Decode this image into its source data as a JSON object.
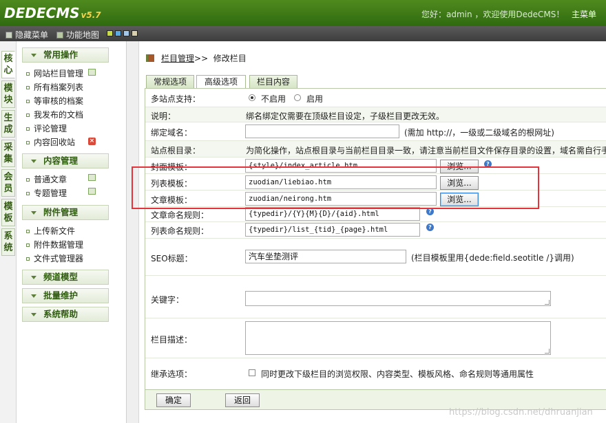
{
  "header": {
    "logo": "DEDECMS",
    "version": "v5.7",
    "greeting": "您好：admin ，欢迎使用DedeCMS！",
    "main_menu": "主菜单"
  },
  "toolbar": {
    "hide_menu": "隐藏菜单",
    "site_map": "功能地图",
    "swatch_colors": [
      "#c8d94a",
      "#5aa9e0",
      "#a3c7e8",
      "#d8cfae"
    ]
  },
  "vtabs": [
    {
      "label": "核心"
    },
    {
      "label": "模块"
    },
    {
      "label": "生成"
    },
    {
      "label": "采集"
    },
    {
      "label": "会员"
    },
    {
      "label": "模板"
    },
    {
      "label": "系统"
    }
  ],
  "menu": {
    "common": {
      "title": "常用操作",
      "items": [
        "网站栏目管理",
        "所有档案列表",
        "等审核的档案",
        "我发布的文档",
        "评论管理",
        "内容回收站"
      ]
    },
    "content": {
      "title": "内容管理",
      "items": [
        "普通文章",
        "专题管理"
      ]
    },
    "attach": {
      "title": "附件管理",
      "items": [
        "上传新文件",
        "附件数据管理",
        "文件式管理器"
      ]
    },
    "channel": {
      "title": "频道模型"
    },
    "batch": {
      "title": "批量维护"
    },
    "help": {
      "title": "系统帮助"
    }
  },
  "breadcrumb": {
    "link": "栏目管理",
    "sep": ">>",
    "current": "修改栏目"
  },
  "tabs": [
    "常规选项",
    "高级选项",
    "栏目内容"
  ],
  "form": {
    "multisite": {
      "label": "多站点支持：",
      "opt_off": "不启用",
      "opt_on": "启用",
      "selected": "不启用"
    },
    "note": {
      "label": "说明：",
      "text": "绑名绑定仅需要在顶级栏目设定，子级栏目更改无效。"
    },
    "domain": {
      "label": "绑定域名：",
      "value": "",
      "hint": "(需加 http://，一级或二级域名的根网址)"
    },
    "siteroot": {
      "label": "站点根目录：",
      "text": "为简化操作，站点根目录与当前栏目目录一致，请注意当前栏目文件保存目录的设置，域名需自行手"
    },
    "cover_tpl": {
      "label": "封面模板：",
      "value": "{style}/index_article.htm",
      "browse": "浏览..."
    },
    "list_tpl": {
      "label": "列表模板：",
      "value": "zuodian/liebiao.htm",
      "browse": "浏览..."
    },
    "article_tpl": {
      "label": "文章模板：",
      "value": "zuodian/neirong.htm",
      "browse": "浏览..."
    },
    "article_rule": {
      "label": "文章命名规则：",
      "value": "{typedir}/{Y}{M}{D}/{aid}.html"
    },
    "list_rule": {
      "label": "列表命名规则：",
      "value": "{typedir}/list_{tid}_{page}.html"
    },
    "seo": {
      "label": "SEO标题：",
      "value": "汽车坐垫测评",
      "hint": "(栏目模板里用{dede:field.seotitle /}调用)"
    },
    "keywords": {
      "label": "关键字：",
      "value": ""
    },
    "description": {
      "label": "栏目描述：",
      "value": ""
    },
    "inherit": {
      "label": "继承选项：",
      "text": "同时更改下级栏目的浏览权限、内容类型、模板风格、命名规则等通用属性"
    }
  },
  "actions": {
    "confirm": "确定",
    "back": "返回"
  },
  "watermark": "https://blog.csdn.net/dhruanjian",
  "colors": {
    "accent": "#3f7a16",
    "highlight": "#e4333a"
  }
}
